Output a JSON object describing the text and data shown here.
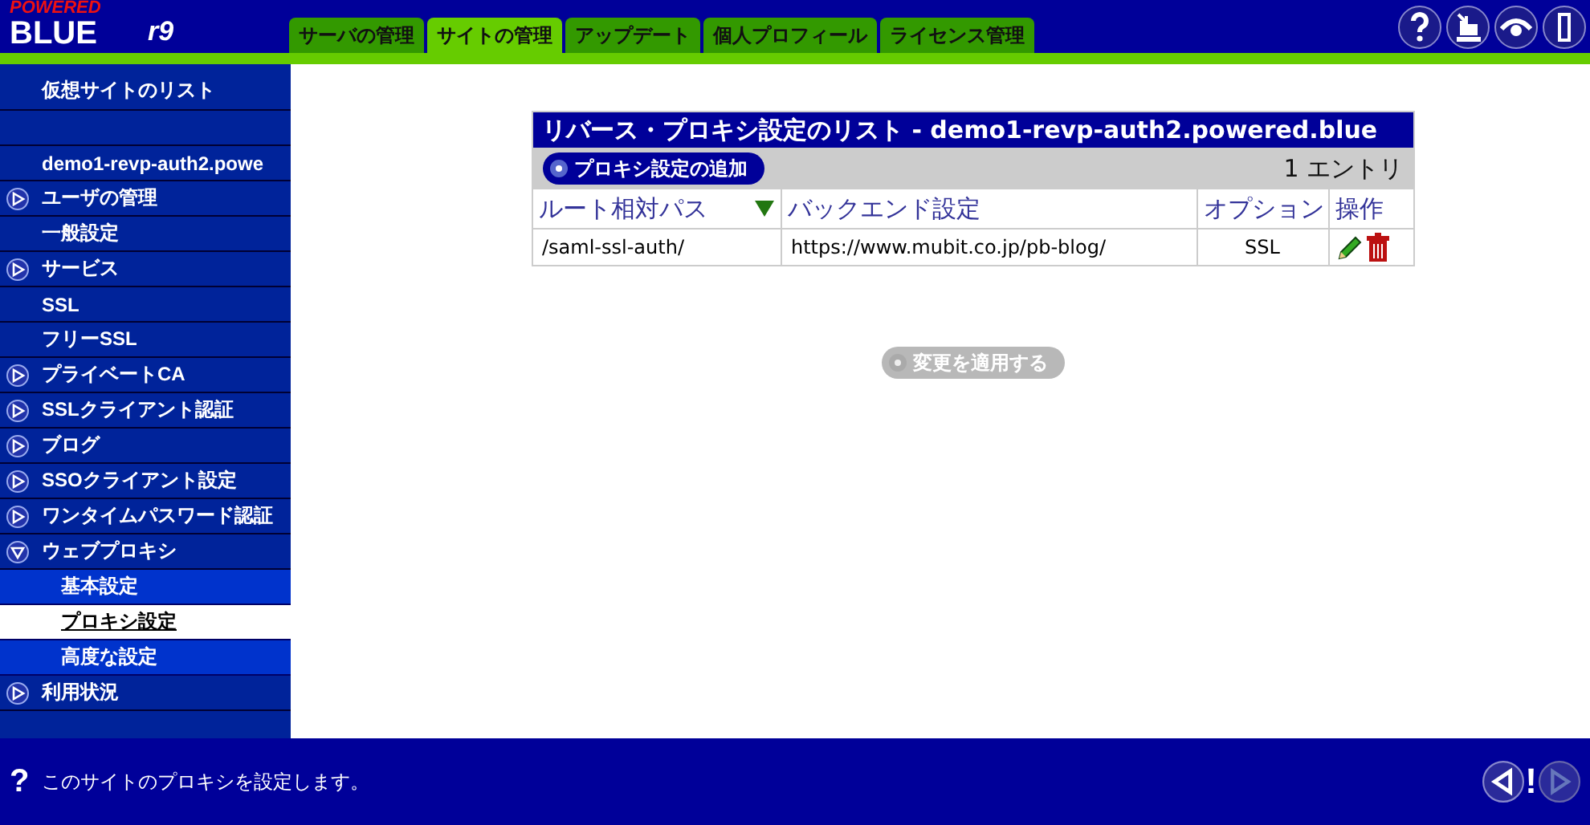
{
  "logo": {
    "top": "POWERED",
    "main": "BLUE",
    "version": "r9"
  },
  "tabs": [
    {
      "label": "サーバの管理",
      "selected": false
    },
    {
      "label": "サイトの管理",
      "selected": true
    },
    {
      "label": "アップデート",
      "selected": false
    },
    {
      "label": "個人プロフィール",
      "selected": false
    },
    {
      "label": "ライセンス管理",
      "selected": false
    }
  ],
  "toolbar_icons": [
    {
      "kind": "help"
    },
    {
      "kind": "install"
    },
    {
      "kind": "view"
    },
    {
      "kind": "logout"
    }
  ],
  "sidebar": {
    "items": [
      {
        "kind": "link",
        "label": "仮想サイトのリスト"
      },
      {
        "kind": "spacer"
      },
      {
        "kind": "link",
        "label": "demo1-revp-auth2.powe"
      },
      {
        "kind": "expander",
        "label": "ユーザの管理",
        "expanded": false
      },
      {
        "kind": "link",
        "label": "一般設定"
      },
      {
        "kind": "expander",
        "label": "サービス",
        "expanded": false
      },
      {
        "kind": "link",
        "label": "SSL"
      },
      {
        "kind": "link",
        "label": "フリーSSL"
      },
      {
        "kind": "expander",
        "label": "プライベートCA",
        "expanded": false
      },
      {
        "kind": "expander",
        "label": "SSLクライアント認証",
        "expanded": false
      },
      {
        "kind": "expander",
        "label": "ブログ",
        "expanded": false
      },
      {
        "kind": "expander",
        "label": "SSOクライアント設定",
        "expanded": false
      },
      {
        "kind": "expander",
        "label": "ワンタイムパスワード認証",
        "expanded": false
      },
      {
        "kind": "expander",
        "label": "ウェブプロキシ",
        "expanded": true,
        "children": [
          {
            "label": "基本設定",
            "selected": false
          },
          {
            "label": "プロキシ設定",
            "selected": true
          },
          {
            "label": "高度な設定",
            "selected": false
          }
        ]
      },
      {
        "kind": "expander",
        "label": "利用状況",
        "expanded": false
      }
    ]
  },
  "table": {
    "title": "リバース・プロキシ設定のリスト - demo1-revp-auth2.powered.blue",
    "add_button": "プロキシ設定の追加",
    "count": "1 エントリ",
    "columns": [
      {
        "label": "ルート相対パス",
        "sorted": true
      },
      {
        "label": "バックエンド設定",
        "sorted": false
      },
      {
        "label": "オプション",
        "sorted": false
      },
      {
        "label": "操作",
        "sorted": false
      }
    ],
    "rows": [
      {
        "path": "/saml-ssl-auth/",
        "backend": "https://www.mubit.co.jp/pb-blog/",
        "option": "SSL"
      }
    ]
  },
  "apply_button": {
    "label": "変更を適用する",
    "disabled": true
  },
  "status_bar": {
    "help_mark": "?",
    "text": "このサイトのプロキシを設定します。",
    "alert_mark": "!"
  }
}
